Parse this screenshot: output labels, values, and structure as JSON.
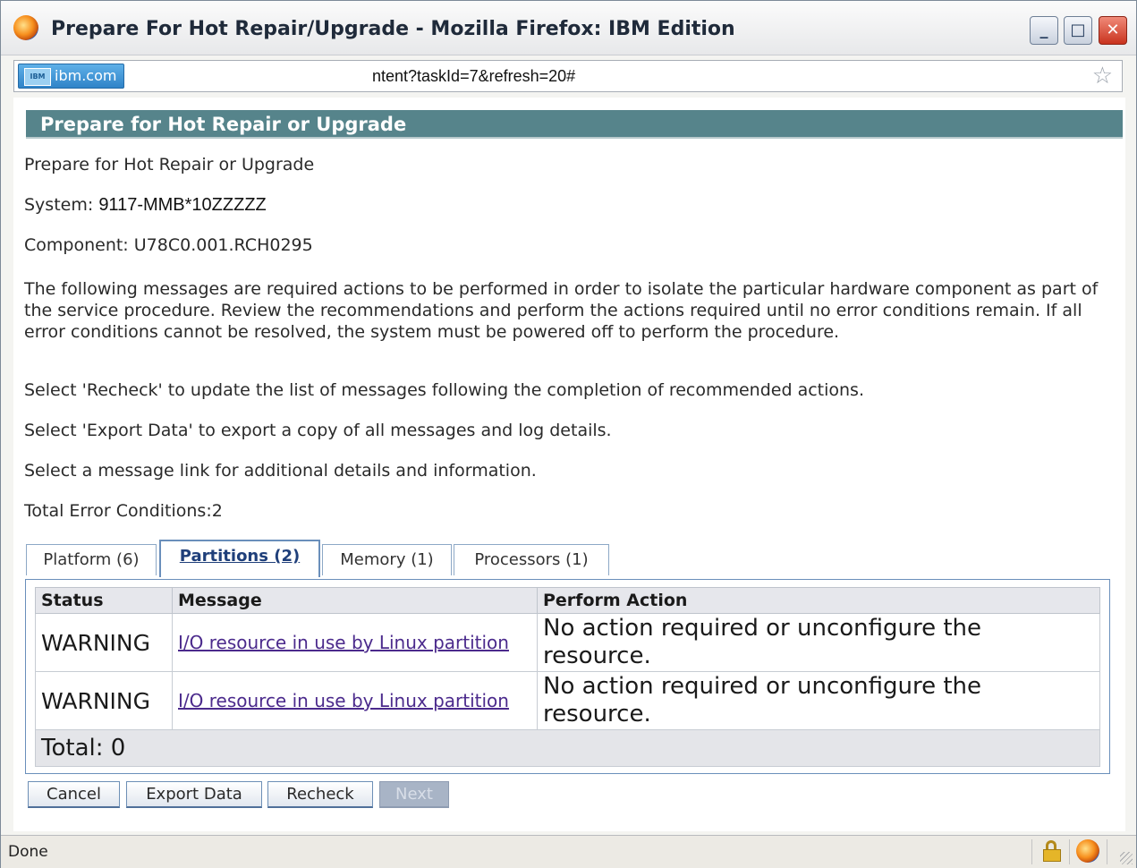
{
  "window": {
    "title": "Prepare For Hot Repair/Upgrade - Mozilla Firefox: IBM Edition",
    "minimize_glyph": "_",
    "maximize_glyph": "□",
    "close_glyph": "✕"
  },
  "addressbar": {
    "site_label": "ibm.com",
    "site_icon_text": "IBM",
    "url": "ntent?taskId=7&refresh=20#",
    "bookmark_glyph": "☆"
  },
  "page": {
    "header": "Prepare for Hot Repair or Upgrade",
    "subtitle": "Prepare for Hot Repair or Upgrade",
    "system_label": "System:",
    "system_value": "9117-MMB*10ZZZZZ",
    "component_label": "Component:",
    "component_value": "U78C0.001.RCH0295",
    "description": "The following messages are required actions to be performed in order to isolate the particular hardware component as part of the service procedure. Review the recommendations and perform the actions required until no error conditions remain. If all error conditions cannot be resolved, the system must be powered off to perform the procedure.",
    "recheck_hint": "Select 'Recheck' to update the list of messages following the completion of recommended actions.",
    "export_hint": "Select 'Export Data' to export a copy of all messages and log details.",
    "message_hint": "Select a message link for additional details and information.",
    "total_errors": "Total Error Conditions:2"
  },
  "tabs": [
    {
      "label": "Platform (6)"
    },
    {
      "label": "Partitions (2)"
    },
    {
      "label": "Memory (1)"
    },
    {
      "label": "Processors (1)"
    }
  ],
  "active_tab": "Partitions (2)",
  "table": {
    "headers": [
      "Status",
      "Message",
      "Perform Action"
    ],
    "rows": [
      {
        "status": "WARNING",
        "message": "I/O resource in use by Linux partition",
        "action": "No action required or unconfigure the resource."
      },
      {
        "status": "WARNING",
        "message": "I/O resource in use by Linux partition",
        "action": "No action required or unconfigure the resource."
      }
    ],
    "total": "Total: 0"
  },
  "buttons": {
    "cancel": "Cancel",
    "export": "Export Data",
    "recheck": "Recheck",
    "next": "Next"
  },
  "statusbar": {
    "text": "Done"
  },
  "colors": {
    "header_bg": "#56848b",
    "tab_border": "#6a8fbb",
    "link": "#4b2a8c"
  }
}
